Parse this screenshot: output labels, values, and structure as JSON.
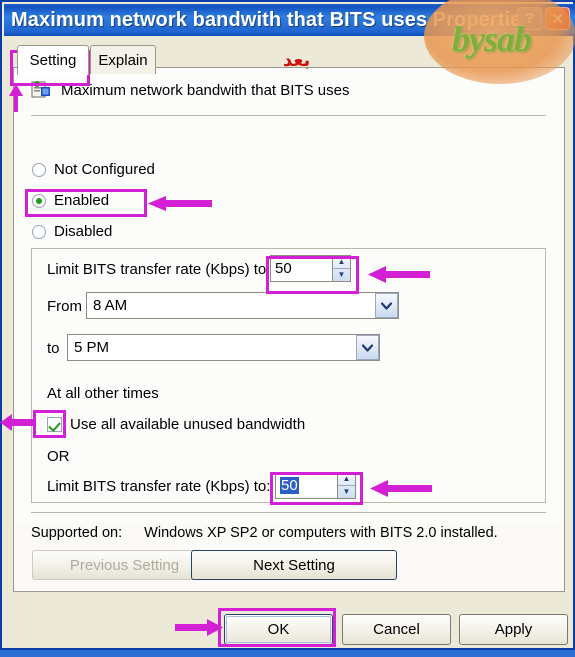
{
  "window": {
    "title": "Maximum network bandwith that BITS uses Properties",
    "help_button": "?",
    "close_button": "✕"
  },
  "watermark": {
    "text": "bysab"
  },
  "annotation": {
    "arabic_note": "بعد",
    "color": "#d420d4"
  },
  "tabs": [
    {
      "label": "Setting",
      "selected": true
    },
    {
      "label": "Explain",
      "selected": false
    }
  ],
  "panel": {
    "heading": "Maximum network bandwith that BITS uses",
    "heading_icon": "policy-setting-icon",
    "radios": [
      {
        "label": "Not Configured",
        "checked": false
      },
      {
        "label": "Enabled",
        "checked": true
      },
      {
        "label": "Disabled",
        "checked": false
      }
    ],
    "group": {
      "limit_rate_label_1": "Limit BITS transfer rate (Kbps) to:",
      "limit_rate_value_1": "50",
      "from_label": "From",
      "from_value": "8 AM",
      "to_label": "to",
      "to_value": "5 PM",
      "at_all_other_times_label": "At all other times",
      "use_all_bandwidth_label": "Use all available unused bandwidth",
      "use_all_bandwidth_checked": true,
      "or_label": "OR",
      "limit_rate_label_2": "Limit BITS transfer rate (Kbps) to:",
      "limit_rate_value_2": "50",
      "spinner_up": "▲",
      "spinner_down": "▼",
      "combo_arrow": "❯"
    },
    "supported_label": "Supported on:",
    "supported_value": "Windows XP SP2 or computers with BITS 2.0 installed.",
    "previous_setting": "Previous Setting",
    "next_setting": "Next Setting"
  },
  "dialog_buttons": {
    "ok": "OK",
    "cancel": "Cancel",
    "apply": "Apply"
  }
}
